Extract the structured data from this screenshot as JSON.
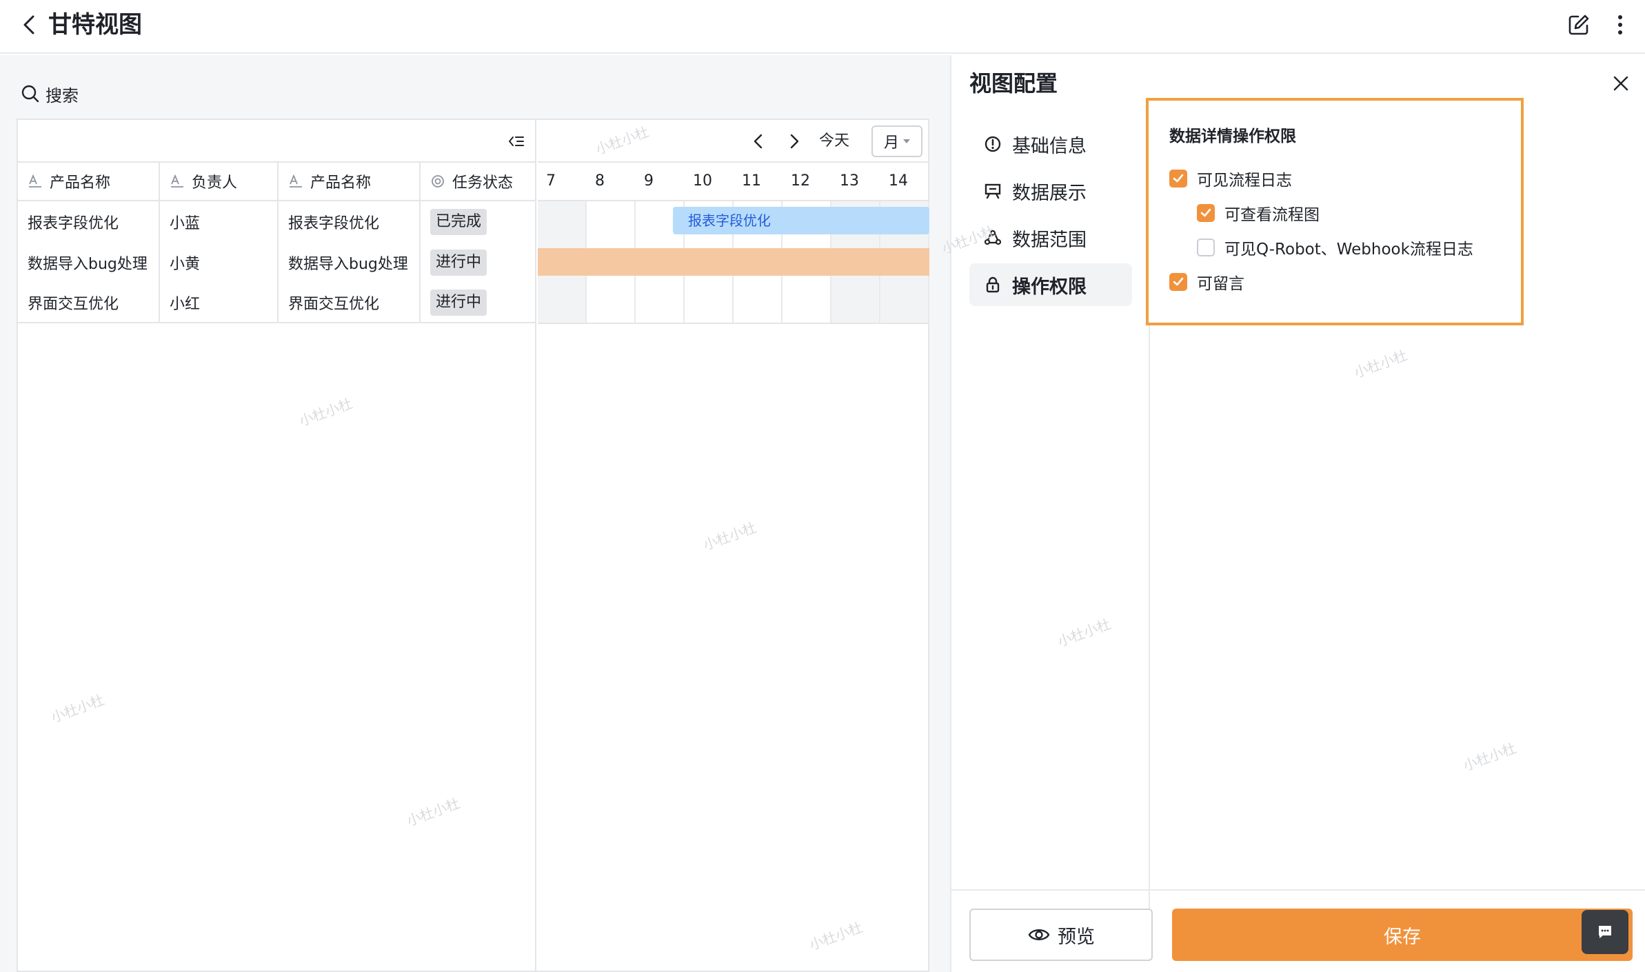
{
  "header": {
    "title": "甘特视图"
  },
  "search": {
    "label": "搜索"
  },
  "table": {
    "columns": [
      "产品名称",
      "负责人",
      "产品名称",
      "任务状态"
    ],
    "rows": [
      {
        "product": "报表字段优化",
        "owner": "小蓝",
        "product2": "报表字段优化",
        "status": "已完成"
      },
      {
        "product": "数据导入bug处理",
        "owner": "小黄",
        "product2": "数据导入bug处理",
        "status": "进行中"
      },
      {
        "product": "界面交互优化",
        "owner": "小红",
        "product2": "界面交互优化",
        "status": "进行中"
      }
    ]
  },
  "gantt": {
    "today_label": "今天",
    "scale": "月",
    "days": [
      "7",
      "8",
      "9",
      "10",
      "11",
      "12",
      "13",
      "14"
    ],
    "bar_label": "报表字段优化",
    "bar_colors": {
      "blue": "#b7dcfb",
      "orange": "#f5c8a2"
    }
  },
  "watermark": "小杜小杜",
  "config": {
    "title": "视图配置",
    "menu": [
      "基础信息",
      "数据展示",
      "数据范围",
      "操作权限"
    ],
    "active_menu": "操作权限",
    "permissions": {
      "title": "数据详情操作权限",
      "items": [
        {
          "label": "可见流程日志",
          "checked": true
        },
        {
          "label": "可查看流程图",
          "checked": true
        },
        {
          "label": "可见Q-Robot、Webhook流程日志",
          "checked": false
        },
        {
          "label": "可留言",
          "checked": true
        }
      ]
    },
    "preview_label": "预览",
    "save_label": "保存",
    "accent_color": "#f0923c"
  }
}
